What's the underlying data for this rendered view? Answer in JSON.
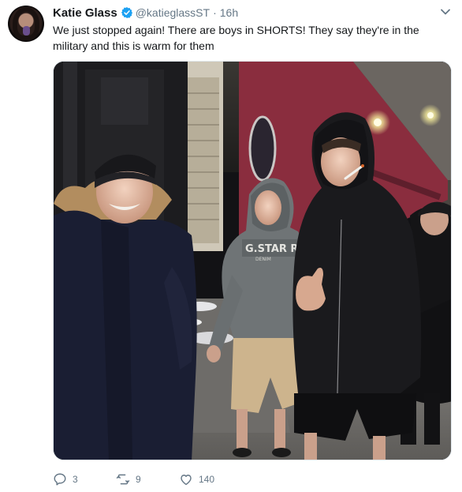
{
  "tweet": {
    "author_name": "Katie Glass",
    "handle": "@katieglassST",
    "separator": "·",
    "time": "16h",
    "text": "We just stopped again! There are boys in SHORTS! They say they're in the military and this is warm for them",
    "photo_shirt_text": "G.STAR RAW",
    "photo_shirt_subtext": "DENIM"
  },
  "actions": {
    "reply_count": "3",
    "retweet_count": "9",
    "like_count": "140"
  },
  "colors": {
    "verified": "#1da1f2",
    "secondary_text": "#657786",
    "train_red": "#8a2d3e"
  },
  "icons": [
    "verified-icon",
    "chevron-down-icon",
    "reply-icon",
    "retweet-icon",
    "like-icon"
  ]
}
